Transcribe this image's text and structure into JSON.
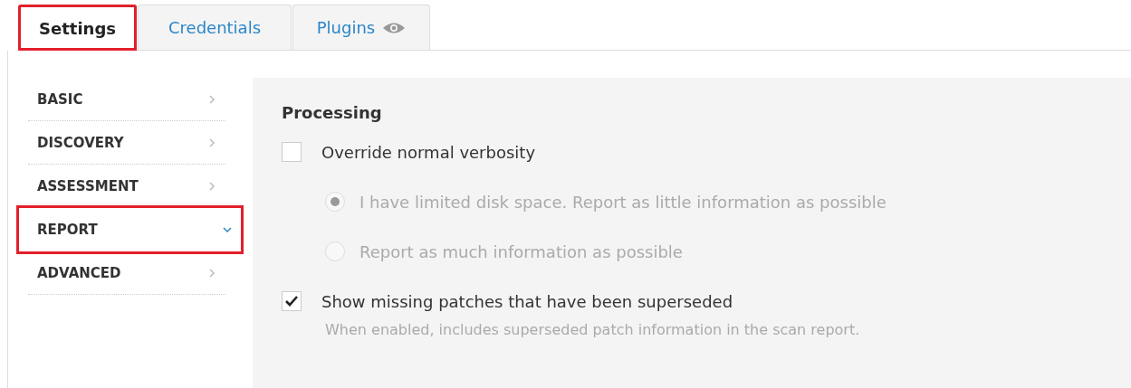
{
  "tabs": [
    {
      "label": "Settings",
      "selected": true,
      "highlighted": true
    },
    {
      "label": "Credentials",
      "selected": false,
      "highlighted": false
    },
    {
      "label": "Plugins",
      "selected": false,
      "highlighted": false
    }
  ],
  "sidebar": {
    "items": [
      {
        "label": "BASIC",
        "expanded": false,
        "highlighted": false
      },
      {
        "label": "DISCOVERY",
        "expanded": false,
        "highlighted": false
      },
      {
        "label": "ASSESSMENT",
        "expanded": false,
        "highlighted": false
      },
      {
        "label": "REPORT",
        "expanded": true,
        "highlighted": true
      },
      {
        "label": "ADVANCED",
        "expanded": false,
        "highlighted": false
      }
    ]
  },
  "section": {
    "title": "Processing",
    "options": [
      {
        "kind": "checkbox",
        "label": "Override normal verbosity",
        "checked": false,
        "disabled": false
      },
      {
        "kind": "radio",
        "label": "I have limited disk space. Report as little information as possible",
        "selected": true,
        "disabled": true
      },
      {
        "kind": "radio",
        "label": "Report as much information as possible",
        "selected": false,
        "disabled": true
      },
      {
        "kind": "checkbox",
        "label": "Show missing patches that have been superseded",
        "checked": true,
        "disabled": false,
        "hint": "When enabled, includes superseded patch information in the scan report."
      }
    ]
  }
}
